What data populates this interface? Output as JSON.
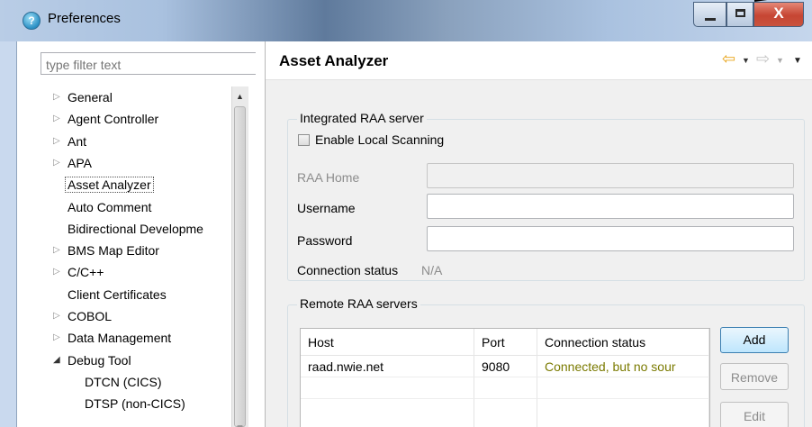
{
  "window": {
    "title": "Preferences",
    "close_glyph": "X"
  },
  "filter": {
    "placeholder": "type filter text"
  },
  "tree": {
    "items": [
      {
        "label": "General",
        "expandable": true
      },
      {
        "label": "Agent Controller",
        "expandable": true
      },
      {
        "label": "Ant",
        "expandable": true
      },
      {
        "label": "APA",
        "expandable": true
      },
      {
        "label": "Asset Analyzer",
        "expandable": false,
        "selected": true
      },
      {
        "label": "Auto Comment",
        "expandable": false
      },
      {
        "label": "Bidirectional Developme",
        "expandable": false
      },
      {
        "label": "BMS Map Editor",
        "expandable": true
      },
      {
        "label": "C/C++",
        "expandable": true
      },
      {
        "label": "Client Certificates",
        "expandable": false
      },
      {
        "label": "COBOL",
        "expandable": true
      },
      {
        "label": "Data Management",
        "expandable": true
      },
      {
        "label": "Debug Tool",
        "expandable": true,
        "expanded": true
      },
      {
        "label": "DTCN (CICS)",
        "expandable": false
      },
      {
        "label": "DTSP (non-CICS)",
        "expandable": false
      }
    ]
  },
  "page": {
    "title": "Asset Analyzer",
    "back_icon": "⇦",
    "forward_icon": "⇨",
    "dropdown_glyph": "▼"
  },
  "integrated": {
    "group_title": "Integrated RAA server",
    "enable_label": "Enable Local Scanning",
    "raa_home_label": "RAA Home",
    "username_label": "Username",
    "password_label": "Password",
    "connection_label": "Connection status",
    "connection_value": "N/A"
  },
  "remote": {
    "group_title": "Remote RAA servers",
    "columns": [
      "Host",
      "Port",
      "Connection status"
    ],
    "rows": [
      {
        "host": "raad.nwie.net",
        "port": "9080",
        "status": "Connected, but no sour"
      }
    ],
    "buttons": {
      "add": "Add",
      "remove": "Remove",
      "edit": "Edit"
    }
  },
  "colors": {
    "status_ok": "#7a7a00",
    "accent": "#3c7fb1",
    "back_arrow": "#e8a51c"
  }
}
